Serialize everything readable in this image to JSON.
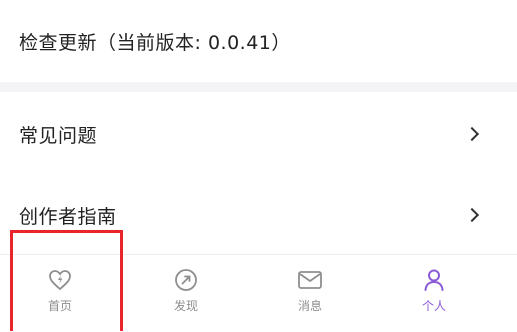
{
  "settings": {
    "check_update": "检查更新（当前版本: 0.0.41）",
    "faq": "常见问题",
    "creator_guide": "创作者指南"
  },
  "tabbar": {
    "items": [
      {
        "label": "首页",
        "icon": "heart-bolt-icon"
      },
      {
        "label": "发现",
        "icon": "compass-icon"
      },
      {
        "label": "消息",
        "icon": "mail-icon"
      },
      {
        "label": "个人",
        "icon": "person-icon"
      }
    ],
    "active_index": 3,
    "active_color": "#8a5bd6",
    "inactive_color": "#8e8e8e"
  },
  "highlight_color": "#e8252a"
}
